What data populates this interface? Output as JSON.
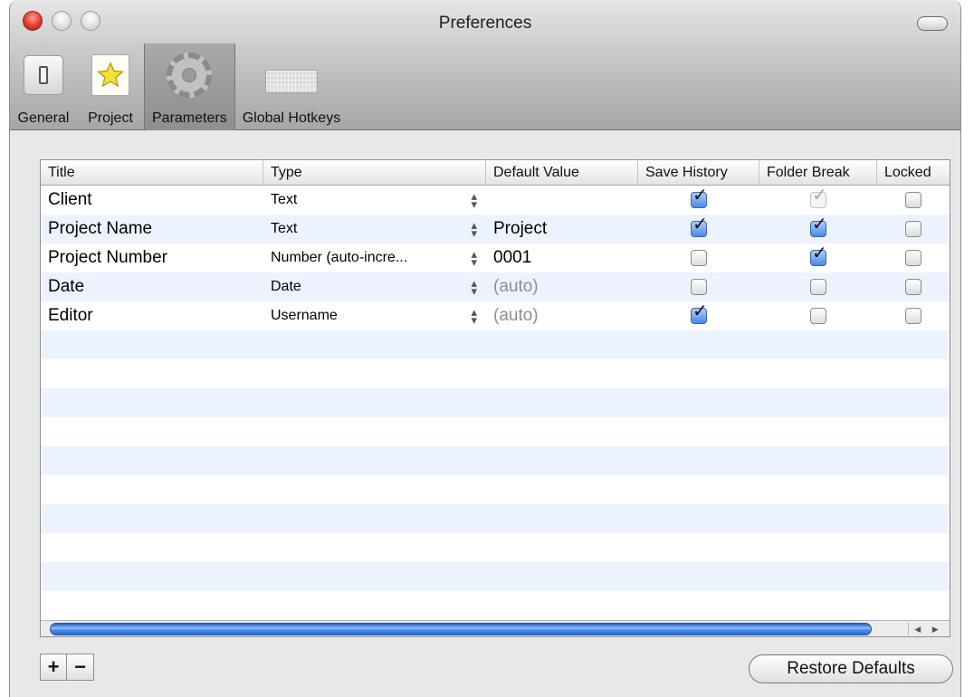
{
  "window": {
    "title": "Preferences"
  },
  "toolbar": {
    "items": [
      {
        "label": "General",
        "icon": "switch-icon",
        "selected": false
      },
      {
        "label": "Project",
        "icon": "star-icon",
        "selected": false
      },
      {
        "label": "Parameters",
        "icon": "gear-icon",
        "selected": true
      },
      {
        "label": "Global Hotkeys",
        "icon": "keyboard-icon",
        "selected": false
      }
    ]
  },
  "table": {
    "columns": [
      "Title",
      "Type",
      "Default Value",
      "Save History",
      "Folder Break",
      "Locked"
    ],
    "rows": [
      {
        "title": "Client",
        "type": "Text",
        "default": "",
        "default_muted": false,
        "save_history": "checked",
        "folder_break": "disabled-checked",
        "locked": "unchecked"
      },
      {
        "title": "Project Name",
        "type": "Text",
        "default": "Project",
        "default_muted": false,
        "save_history": "checked",
        "folder_break": "checked",
        "locked": "unchecked"
      },
      {
        "title": "Project Number",
        "type": "Number (auto-incre...",
        "default": "0001",
        "default_muted": false,
        "save_history": "unchecked",
        "folder_break": "checked",
        "locked": "unchecked"
      },
      {
        "title": "Date",
        "type": "Date",
        "default": "(auto)",
        "default_muted": true,
        "save_history": "unchecked",
        "folder_break": "unchecked",
        "locked": "unchecked"
      },
      {
        "title": "Editor",
        "type": "Username",
        "default": "(auto)",
        "default_muted": true,
        "save_history": "checked",
        "folder_break": "unchecked",
        "locked": "unchecked"
      }
    ],
    "empty_rows": 10
  },
  "buttons": {
    "add": "+",
    "remove": "−",
    "restore": "Restore Defaults"
  },
  "colors": {
    "row_alt": "#edf3fe",
    "scroll_thumb": "#4a90ea",
    "close_light": "#e23a2b"
  }
}
